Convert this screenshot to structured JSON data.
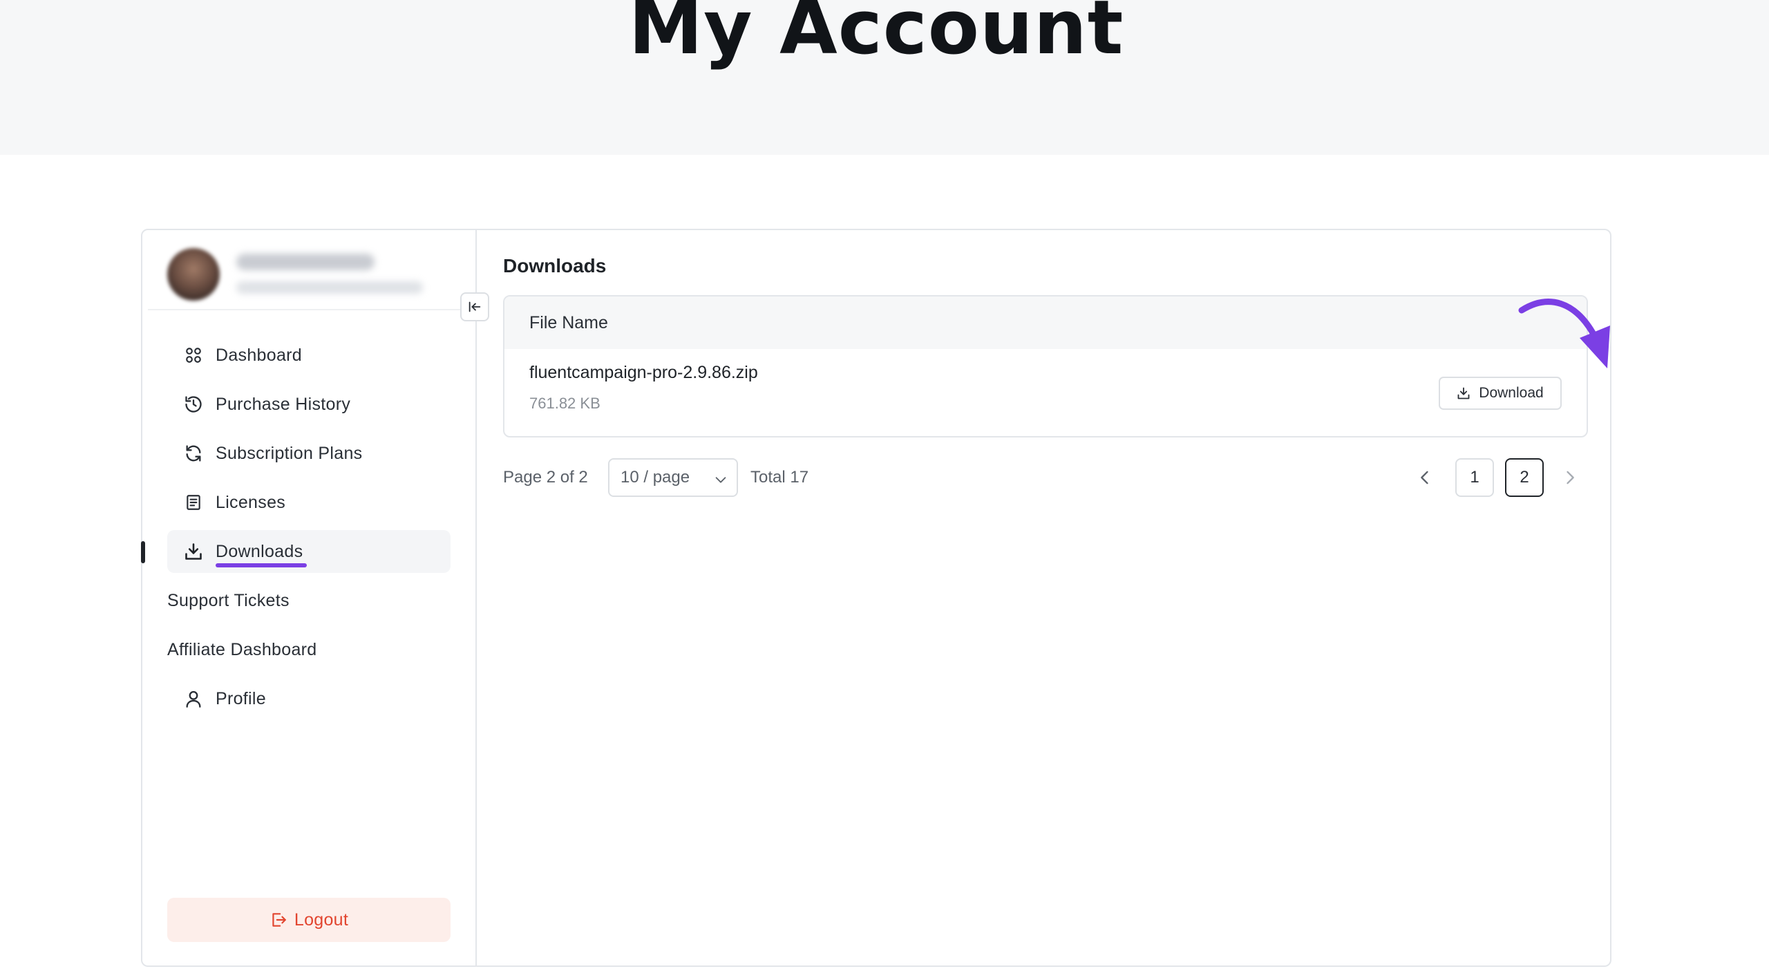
{
  "page": {
    "title": "My Account"
  },
  "sidebar": {
    "items": [
      {
        "label": "Dashboard",
        "icon": "grid-icon"
      },
      {
        "label": "Purchase History",
        "icon": "history-icon"
      },
      {
        "label": "Subscription Plans",
        "icon": "refresh-icon"
      },
      {
        "label": "Licenses",
        "icon": "document-icon"
      },
      {
        "label": "Downloads",
        "icon": "download-icon",
        "active": true
      },
      {
        "label": "Support Tickets",
        "icon": ""
      },
      {
        "label": "Affiliate Dashboard",
        "icon": ""
      },
      {
        "label": "Profile",
        "icon": "user-icon"
      }
    ],
    "logout_label": "Logout"
  },
  "main": {
    "section_title": "Downloads",
    "table": {
      "column_header": "File Name",
      "rows": [
        {
          "file_name": "fluentcampaign-pro-2.9.86.zip",
          "file_size": "761.82 KB",
          "action_label": "Download"
        }
      ]
    },
    "pagination": {
      "page_info": "Page 2 of 2",
      "per_page": "10 / page",
      "total": "Total 17",
      "pages": [
        "1",
        "2"
      ],
      "current_page": "2"
    }
  },
  "colors": {
    "accent_annotation": "#7b3fe4",
    "logout_text": "#e2452f",
    "logout_bg": "#fdeeea",
    "hero_bg": "#f6f7f8"
  }
}
